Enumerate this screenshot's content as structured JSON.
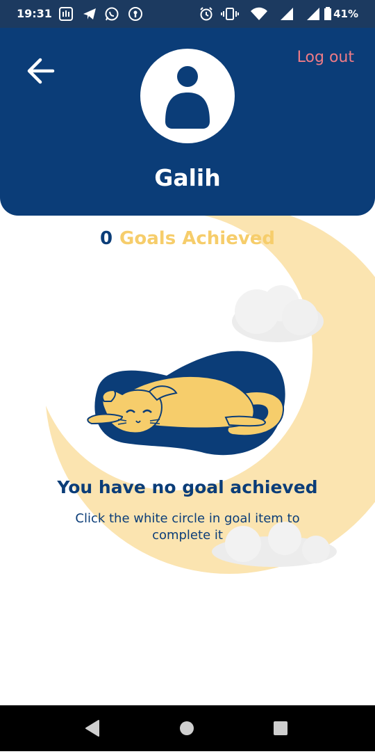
{
  "status_bar": {
    "time": "19:31",
    "battery_percent": "41%",
    "icons": [
      "notification-app-icon",
      "telegram-icon",
      "whatsapp-icon",
      "keyhole-icon",
      "alarm-icon",
      "vibrate-icon",
      "wifi-icon",
      "signal-icon",
      "signal-icon",
      "battery-icon"
    ]
  },
  "header": {
    "logout_label": "Log out",
    "user_name": "Galih"
  },
  "summary": {
    "goals_count": "0",
    "goals_label": "Goals Achieved"
  },
  "empty_state": {
    "title": "You have no goal achieved",
    "subtitle": "Click the white circle in goal item to complete it"
  },
  "colors": {
    "header_bg": "#0b3d78",
    "accent_yellow": "#f6cd6b",
    "logout_red": "#ef7b86",
    "moon": "#fbe4b0"
  },
  "nav_bar": {
    "items": [
      "back-icon",
      "home-icon",
      "recents-icon"
    ]
  }
}
